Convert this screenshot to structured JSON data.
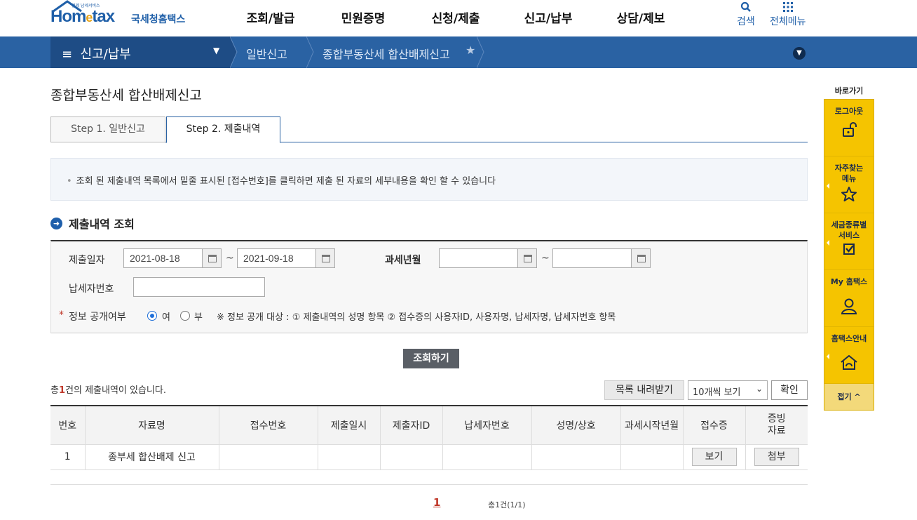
{
  "header": {
    "logo_tagline": "언제 납세서비스",
    "logo_mark_pre": "Hom",
    "logo_mark_e": "e",
    "logo_mark_post": "tax",
    "logo_kor": "국세청홈택스",
    "gnb": [
      "조회/발급",
      "민원증명",
      "신청/제출",
      "신고/납부",
      "상담/제보"
    ],
    "search_label": "검색",
    "allmenu_label": "전체메뉴"
  },
  "locbar": {
    "menu_title": "신고/납부",
    "crumb1": "일반신고",
    "crumb2": "종합부동산세 합산배제신고"
  },
  "page": {
    "title": "종합부동산세 합산배제신고",
    "tabs": [
      "Step 1. 일반신고",
      "Step 2. 제출내역"
    ],
    "notice": "조회 된 제출내역 목록에서 밑줄 표시된 [접수번호]를 클릭하면 제출 된 자료의 세부내용을 확인 할 수 있습니다",
    "section_title": "제출내역 조회"
  },
  "search": {
    "date_label": "제출일자",
    "date_from": "2021-08-18",
    "date_to": "2021-09-18",
    "tilde": "~",
    "tax_ym_label": "과세년월",
    "tax_ym_from": "",
    "tax_ym_to": "",
    "taxpayer_no_label": "납세자번호",
    "taxpayer_no_value": "",
    "disclose_mark": "*",
    "disclose_label": "정보 공개여부",
    "opt_yes": "여",
    "opt_no": "부",
    "disclose_note": "※ 정보 공개 대상 : ① 제출내역의 성명 항목 ② 접수증의 사용자ID, 사용자명, 납세자명, 납세자번호 항목",
    "submit": "조회하기"
  },
  "list": {
    "total_pre": "총",
    "total_count": "1",
    "total_post": "건의 제출내역이 있습니다.",
    "download": "목록 내려받기",
    "page_size": "10개씩 보기",
    "confirm": "확인",
    "columns": [
      "번호",
      "자료명",
      "접수번호",
      "제출일시",
      "제출자ID",
      "납세자번호",
      "성명/상호",
      "과세시작년월",
      "접수증",
      "증빙\n자료"
    ],
    "rows": [
      {
        "no": "1",
        "name": "종부세 합산배제 신고",
        "receipt_no": "",
        "submitted_at": "",
        "submitter_id": "",
        "taxpayer_no": "",
        "person": "",
        "tax_start": "",
        "receipt_btn": "보기",
        "evidence_btn": "첨부"
      }
    ]
  },
  "pager": {
    "current": "1",
    "summary": "총1건(1/1)"
  },
  "quick": {
    "head": "바로가기",
    "items": [
      "로그아웃",
      "자주찾는 메뉴",
      "세금종류별 서비스",
      "My 홈택스",
      "홈택스안내"
    ],
    "fold": "접기 ^"
  },
  "colors": {
    "brand_blue": "#2a62a3",
    "brand_dark": "#1e4c85",
    "quick_yellow": "#f5c400",
    "accent_red": "#c0392b"
  }
}
